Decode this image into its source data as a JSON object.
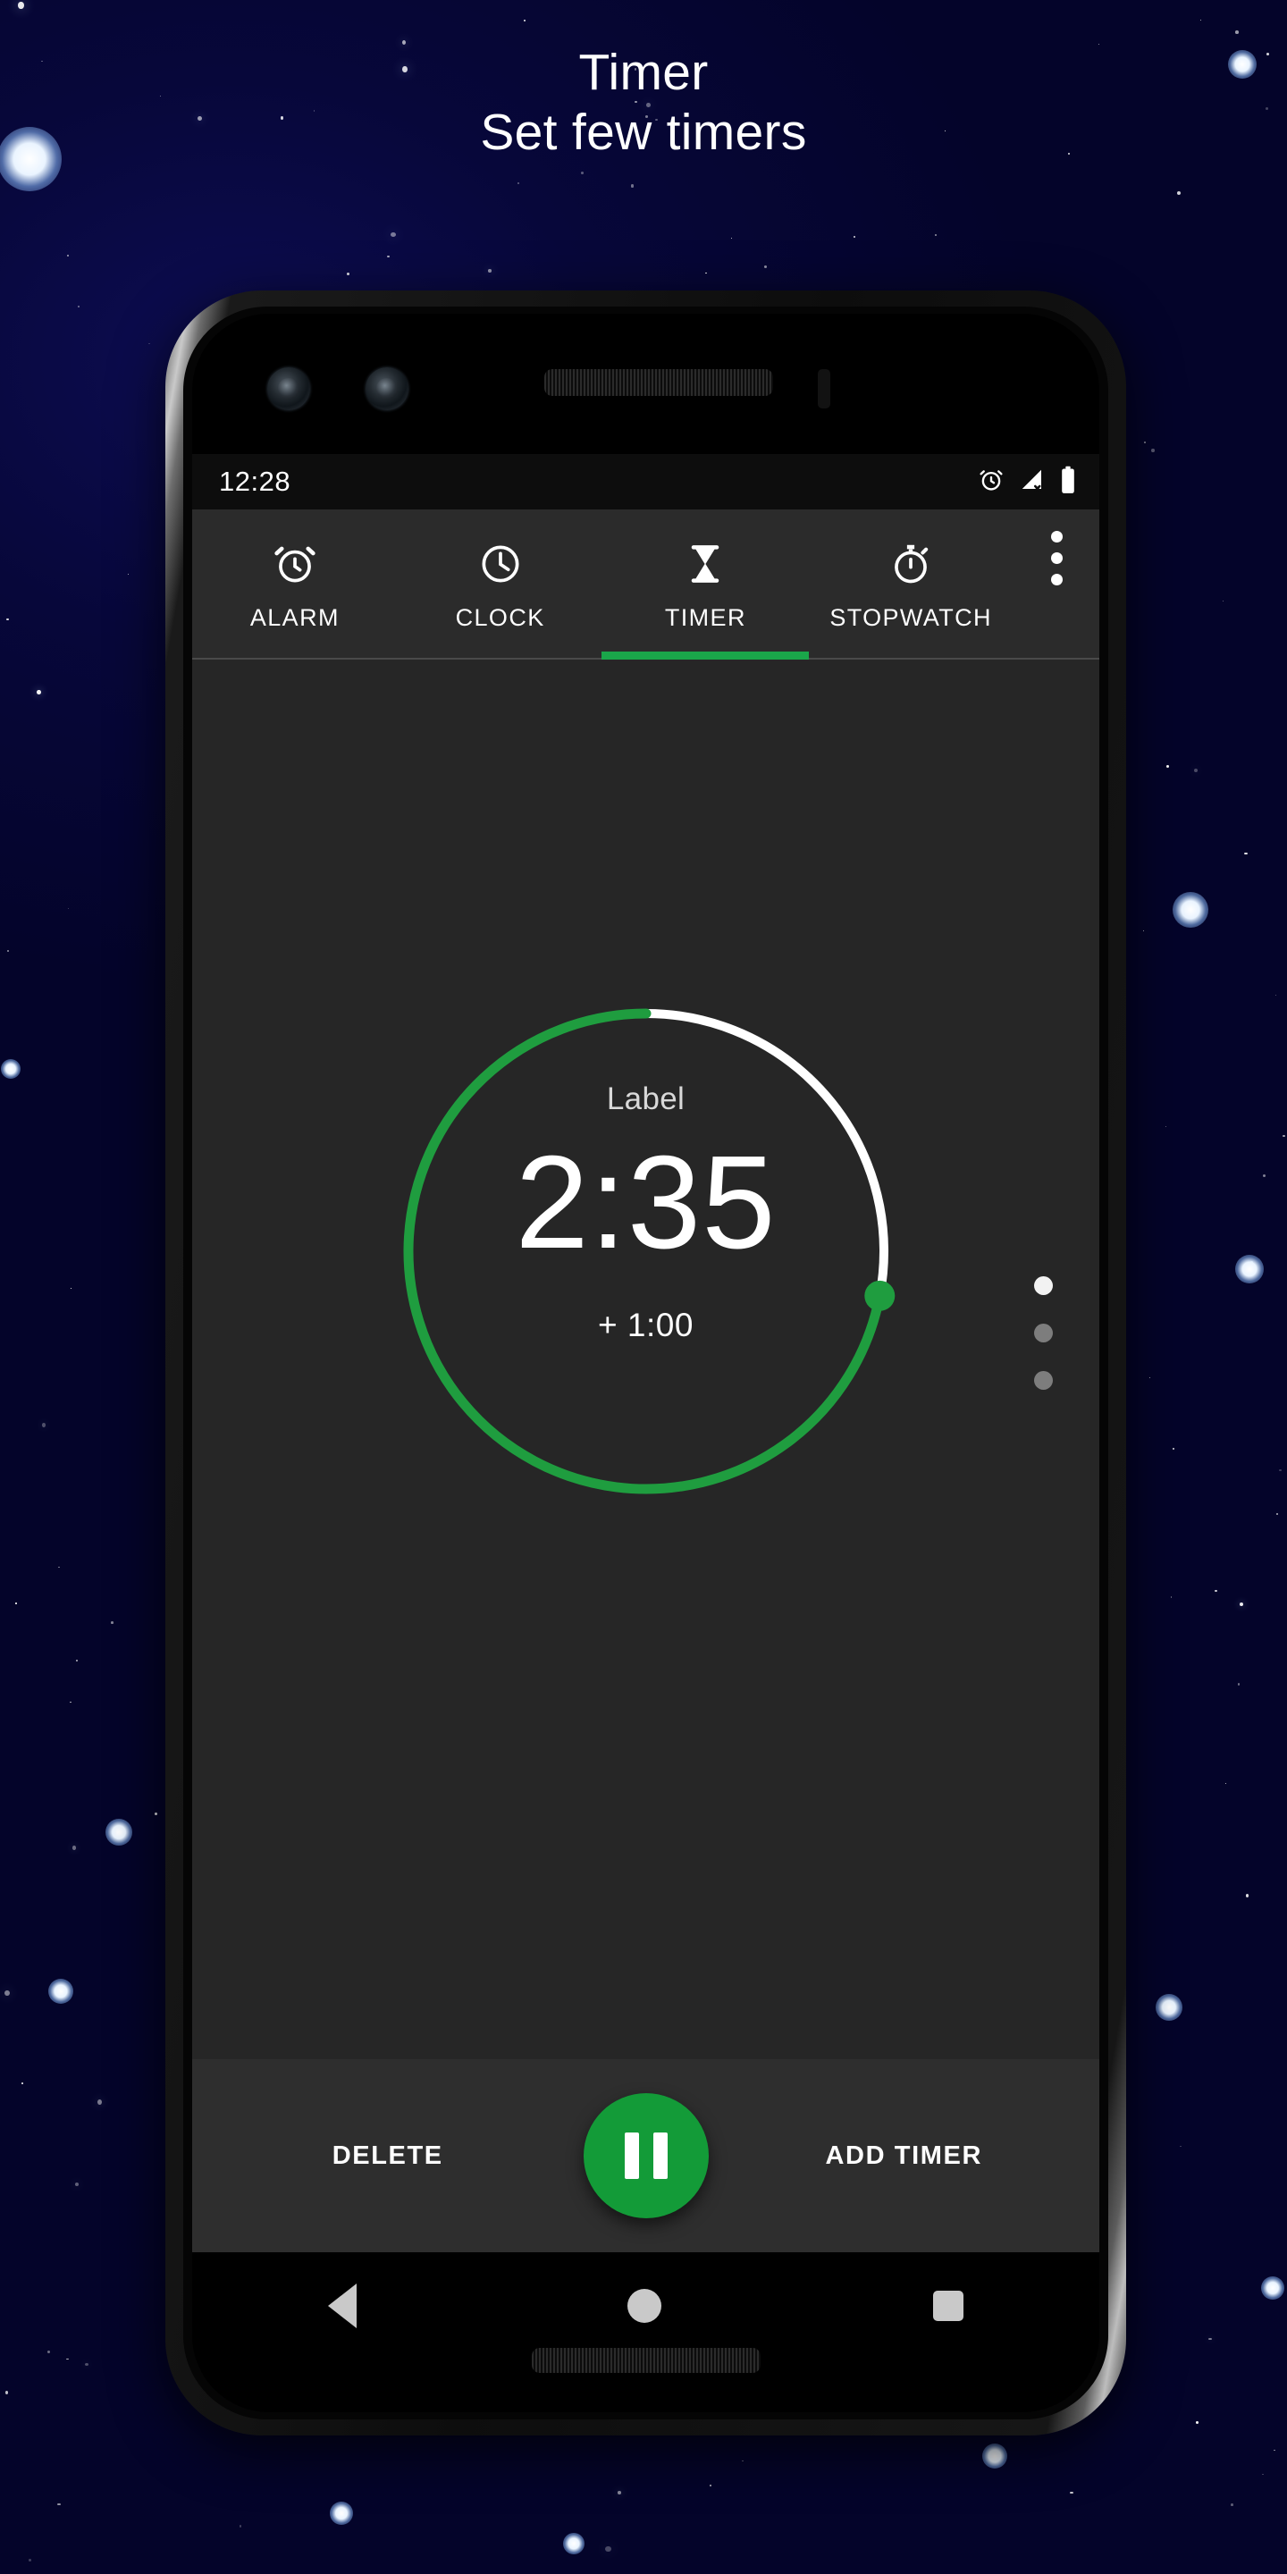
{
  "headline": {
    "title": "Timer",
    "subtitle": "Set few timers"
  },
  "colors": {
    "background": "#05052e",
    "screen_background": "#262626",
    "tab_background": "#2b2b2b",
    "accent_green": "#1aa64a",
    "fab_green": "#139b38",
    "action_bar": "#2e2e2e",
    "text_primary": "#ffffff",
    "text_secondary": "#d8d8d8"
  },
  "status_bar": {
    "time": "12:28",
    "icons": [
      "alarm-icon",
      "signal-off-icon",
      "battery-icon"
    ]
  },
  "tabs": [
    {
      "label": "ALARM",
      "icon": "alarm-clock-icon",
      "active": false
    },
    {
      "label": "CLOCK",
      "icon": "clock-icon",
      "active": false
    },
    {
      "label": "TIMER",
      "icon": "hourglass-icon",
      "active": true
    },
    {
      "label": "STOPWATCH",
      "icon": "stopwatch-icon",
      "active": false
    }
  ],
  "overflow_menu": {
    "icon": "more-vertical-icon"
  },
  "timer": {
    "label": "Label",
    "time_remaining": "2:35",
    "add_minute_label": "+ 1:00",
    "progress_percent": 72,
    "ring_track_color": "#ffffff",
    "ring_progress_color": "#1f9d3f"
  },
  "page_indicator": {
    "count": 3,
    "active_index": 0
  },
  "actions": {
    "delete_label": "DELETE",
    "add_timer_label": "ADD TIMER",
    "fab_icon": "pause-icon"
  },
  "nav_bar": {
    "back_icon": "back-triangle-icon",
    "home_icon": "home-circle-icon",
    "recents_icon": "recents-square-icon"
  }
}
